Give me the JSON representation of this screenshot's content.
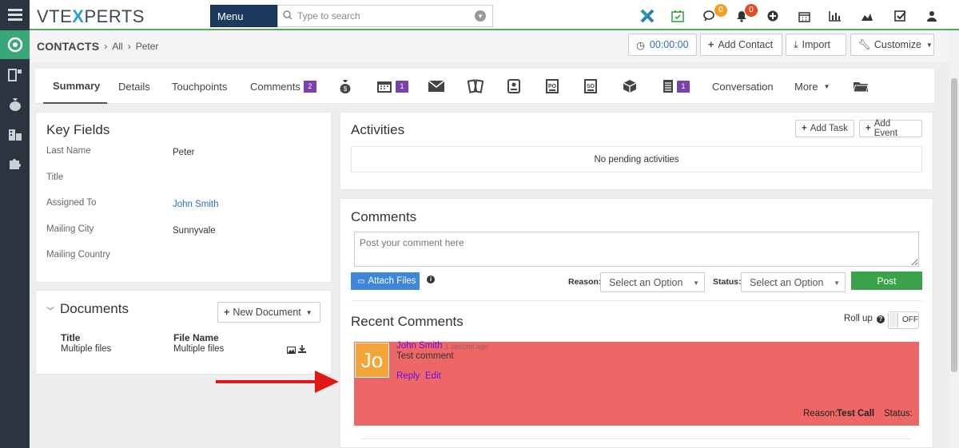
{
  "topbar": {
    "logo_prefix": "VTE",
    "logo_x": "X",
    "logo_suffix": "PERTS",
    "menu_label": "Menu",
    "search_placeholder": "Type to search",
    "comments_badge": "0",
    "notifications_badge": "0"
  },
  "breadcrumb": {
    "module": "CONTACTS",
    "all": "All",
    "record": "Peter"
  },
  "actions": {
    "timer": "00:00:00",
    "add_contact": "Add Contact",
    "import": "Import",
    "customize": "Customize"
  },
  "tabs": {
    "summary": "Summary",
    "details": "Details",
    "touchpoints": "Touchpoints",
    "comments": "Comments",
    "comments_count": "2",
    "calendar_count": "1",
    "docs_count": "1",
    "conversation": "Conversation",
    "more": "More"
  },
  "key_fields": {
    "title": "Key Fields",
    "rows": [
      {
        "label": "Last Name",
        "value": "Peter"
      },
      {
        "label": "Title",
        "value": ""
      },
      {
        "label": "Assigned To",
        "value": "John Smith"
      },
      {
        "label": "Mailing City",
        "value": "Sunnyvale"
      },
      {
        "label": "Mailing Country",
        "value": ""
      }
    ]
  },
  "documents": {
    "title": "Documents",
    "new_document": "New Document",
    "col_title": "Title",
    "col_filename": "File Name",
    "row_title": "Multiple files",
    "row_filename": "Multiple files"
  },
  "activities": {
    "title": "Activities",
    "add_task": "Add Task",
    "add_event": "Add Event",
    "empty": "No pending activities"
  },
  "comments": {
    "title": "Comments",
    "placeholder": "Post your comment here",
    "attach_files": "Attach Files",
    "reason_label": "Reason:",
    "reason_value": "Select an Option",
    "status_label": "Status:",
    "status_value": "Select an Option",
    "post": "Post"
  },
  "recent": {
    "title": "Recent Comments",
    "rollup": "Roll up",
    "toggle": "OFF",
    "comment": {
      "avatar": "Jo",
      "author": "John Smith",
      "time": "1 second ago",
      "text": "Test comment",
      "reply": "Reply",
      "edit": "Edit",
      "reason_label": "Reason:",
      "reason_value": "Test Call",
      "status_label": "Status:"
    }
  },
  "colors": {
    "comment_bg": "#ee6767",
    "arrow": "#e01818",
    "post_button": "#3aa34a",
    "attach_button": "#3c87d9",
    "badge_orange": "#f0a020",
    "badge_red": "#e04b28",
    "tab_badge": "#7b3fae"
  }
}
